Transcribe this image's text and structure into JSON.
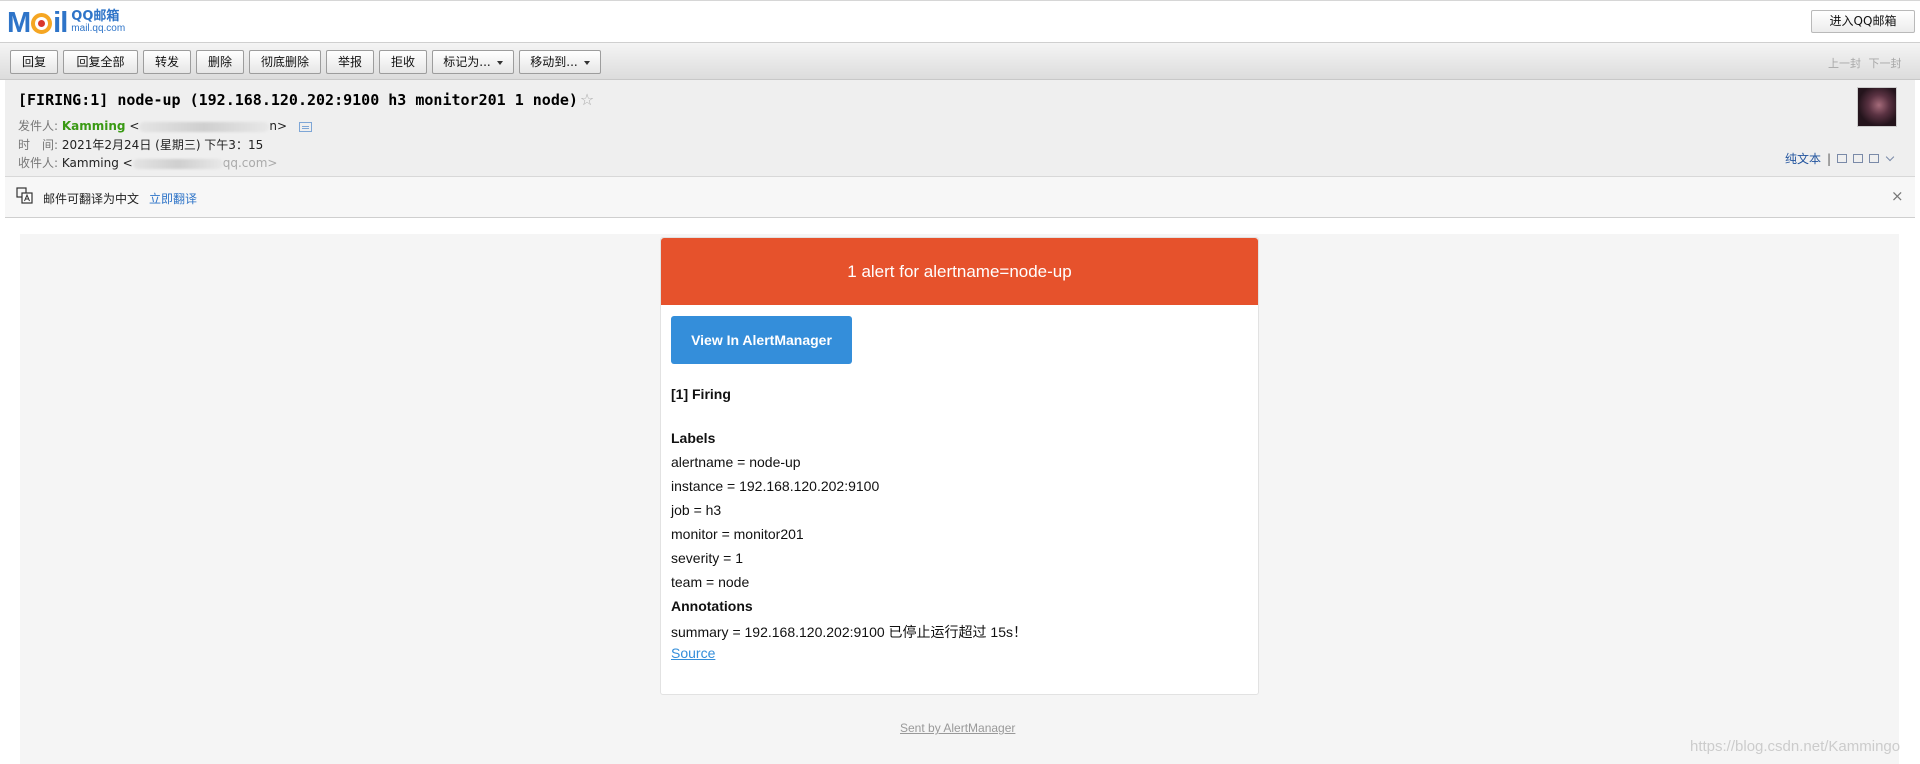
{
  "topbar": {
    "logo_word_left": "M",
    "logo_word_right": "il",
    "logo_sub_top": "QQ邮箱",
    "logo_sub_bottom": "mail.qq.com",
    "enter_button": "进入QQ邮箱"
  },
  "toolbar": {
    "reply": "回复",
    "reply_all": "回复全部",
    "forward": "转发",
    "delete": "删除",
    "delete_permanently": "彻底删除",
    "report": "举报",
    "reject": "拒收",
    "mark_as": "标记为...",
    "move_to": "移动到...",
    "prev": "上一封",
    "next": "下一封"
  },
  "header": {
    "subject": "[FIRING:1] node-up (192.168.120.202:9100 h3 monitor201 1 node)",
    "star": "☆",
    "from_label": "发件人:",
    "from_name": "Kamming",
    "from_email_start": "<",
    "from_email_end": "n>",
    "time_label": "时　间:",
    "time_value": "2021年2月24日 (星期三) 下午3：15",
    "to_label": "收件人:",
    "to_name": "Kamming",
    "to_email_start": "<",
    "to_email_end": "qq.com>",
    "plain_text": "纯文本",
    "separator": "|"
  },
  "translate": {
    "message": "邮件可翻译为中文",
    "action": "立即翻译",
    "close": "×"
  },
  "alert": {
    "header": "1 alert for alertname=node-up",
    "button": "View In AlertManager",
    "firing": "[1] Firing",
    "labels_title": "Labels",
    "labels": [
      "alertname = node-up",
      "instance = 192.168.120.202:9100",
      "job = h3",
      "monitor = monitor201",
      "severity = 1",
      "team = node"
    ],
    "annotations_title": "Annotations",
    "summary": "summary = 192.168.120.202:9100 已停止运行超过 15s！",
    "source": "Source",
    "sent_by": "Sent by AlertManager"
  },
  "watermark": "https://blog.csdn.net/Kammingo"
}
